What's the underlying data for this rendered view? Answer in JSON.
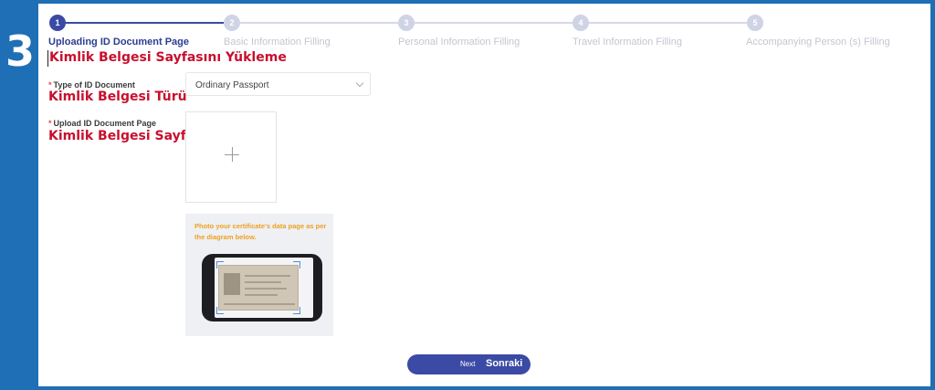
{
  "step_badge": "3",
  "stepper": {
    "steps": [
      {
        "number": "1",
        "label": "Uploading ID Document Page",
        "active": true
      },
      {
        "number": "2",
        "label": "Basic Information Filling",
        "active": false
      },
      {
        "number": "3",
        "label": "Personal Information Filling",
        "active": false
      },
      {
        "number": "4",
        "label": "Travel Information Filling",
        "active": false
      },
      {
        "number": "5",
        "label": "Accompanying Person (s) Filling",
        "active": false
      }
    ]
  },
  "translations": {
    "page_title": "Kimlik Belgesi Sayfasını Yükleme",
    "id_type": "Kimlik Belgesi Türü",
    "upload_page": "Kimlik Belgesi Sayfasını Yükle",
    "next": "Sonraki"
  },
  "form": {
    "id_type": {
      "required_mark": "*",
      "label": "Type of ID Document",
      "value": "Ordinary Passport"
    },
    "upload": {
      "required_mark": "*",
      "label": "Upload ID Document Page"
    }
  },
  "example": {
    "text": "Photo your certificate's data page as per the diagram below."
  },
  "next_button": {
    "label": "Next"
  },
  "colors": {
    "frame": "#1e6fb5",
    "primary": "#3b4aa4",
    "translation": "#c8102e",
    "hint": "#f0a020"
  }
}
